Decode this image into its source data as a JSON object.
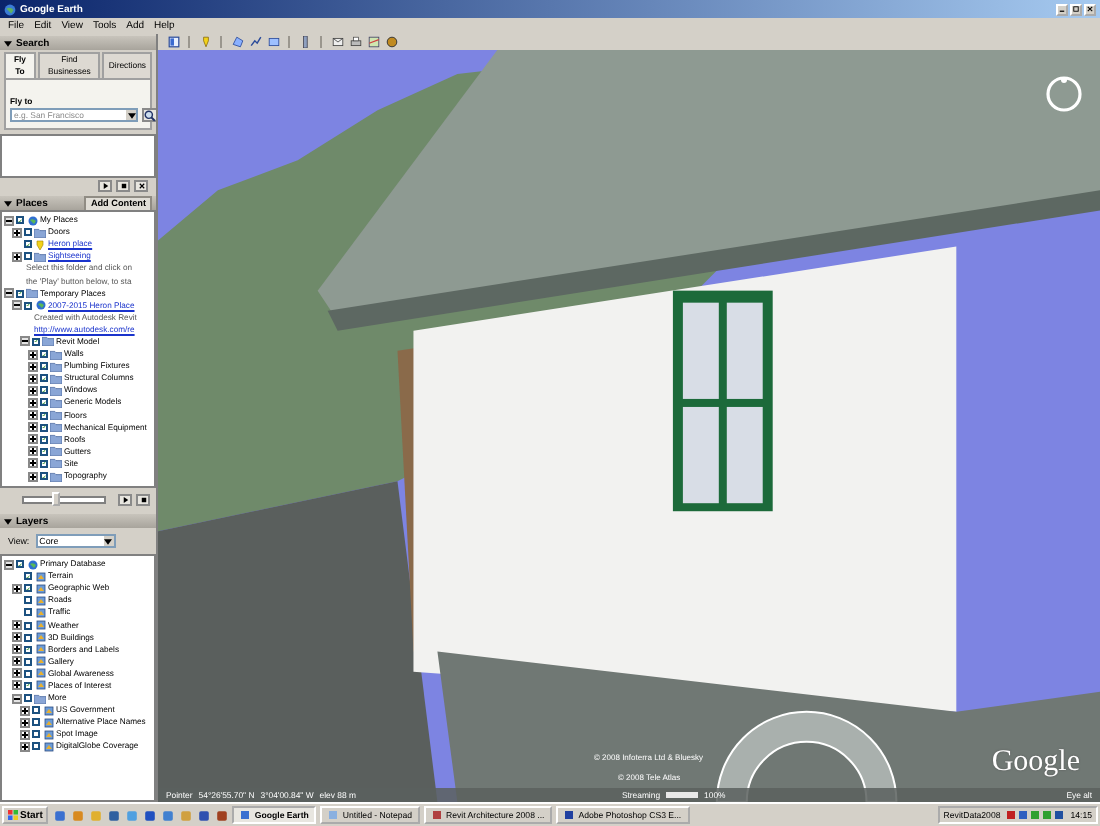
{
  "window": {
    "title": "Google Earth"
  },
  "menu": [
    "File",
    "Edit",
    "View",
    "Tools",
    "Add",
    "Help"
  ],
  "search": {
    "title": "Search",
    "tabs": [
      {
        "label": "Fly To",
        "selected": true
      },
      {
        "label": "Find Businesses",
        "selected": false
      },
      {
        "label": "Directions",
        "selected": false
      }
    ],
    "label": "Fly to",
    "placeholder": "e.g. San Francisco"
  },
  "places": {
    "title": "Places",
    "add_button": "Add Content",
    "items": [
      {
        "kind": "globe",
        "label": "My Places",
        "checked": true,
        "expanded": true,
        "children": [
          {
            "kind": "folder",
            "label": "Doors",
            "checked": false,
            "expanded": false
          },
          {
            "kind": "pin",
            "label": "Heron place",
            "checked": true,
            "link": true
          },
          {
            "kind": "folder",
            "label": "Sightseeing",
            "checked": false,
            "expanded": false,
            "link": true
          },
          {
            "kind": "note",
            "label": "Select this folder and click on"
          },
          {
            "kind": "note",
            "label": "the 'Play' button below, to sta"
          }
        ]
      },
      {
        "kind": "folder",
        "label": "Temporary Places",
        "checked": true,
        "expanded": true,
        "children": [
          {
            "kind": "globe",
            "label": "2007-2015 Heron Place",
            "checked": true,
            "expanded": true,
            "link": true,
            "children": [
              {
                "kind": "note",
                "label": "Created with Autodesk Revit"
              },
              {
                "kind": "note",
                "label": "http://www.autodesk.com/re",
                "link": true
              },
              {
                "kind": "folder",
                "label": "Revit Model",
                "checked": true,
                "expanded": true,
                "children": [
                  {
                    "kind": "folder",
                    "label": "Walls",
                    "checked": true,
                    "expanded": false
                  },
                  {
                    "kind": "folder",
                    "label": "Plumbing Fixtures",
                    "checked": true,
                    "expanded": false
                  },
                  {
                    "kind": "folder",
                    "label": "Structural Columns",
                    "checked": true,
                    "expanded": false
                  },
                  {
                    "kind": "folder",
                    "label": "Windows",
                    "checked": true,
                    "expanded": false
                  },
                  {
                    "kind": "folder",
                    "label": "Generic Models",
                    "checked": true,
                    "expanded": false
                  },
                  {
                    "kind": "folder",
                    "label": "Floors",
                    "checked": true,
                    "expanded": false
                  },
                  {
                    "kind": "folder",
                    "label": "Mechanical Equipment",
                    "checked": true,
                    "expanded": false
                  },
                  {
                    "kind": "folder",
                    "label": "Roofs",
                    "checked": true,
                    "expanded": false
                  },
                  {
                    "kind": "folder",
                    "label": "Gutters",
                    "checked": true,
                    "expanded": false
                  },
                  {
                    "kind": "folder",
                    "label": "Site",
                    "checked": true,
                    "expanded": false
                  },
                  {
                    "kind": "folder",
                    "label": "Topography",
                    "checked": true,
                    "expanded": false
                  }
                ]
              }
            ]
          }
        ]
      }
    ],
    "tour": {
      "level": 0.4
    }
  },
  "layers": {
    "title": "Layers",
    "view_label": "View:",
    "view_value": "Core",
    "items": [
      {
        "kind": "globe",
        "label": "Primary Database",
        "checked": true,
        "expanded": true,
        "children": [
          {
            "kind": "layer",
            "label": "Terrain",
            "checked": true
          },
          {
            "kind": "layer",
            "label": "Geographic Web",
            "checked": true,
            "expanded": false
          },
          {
            "kind": "layer",
            "label": "Roads",
            "checked": false
          },
          {
            "kind": "layer",
            "label": "Traffic",
            "checked": false
          },
          {
            "kind": "layer",
            "label": "Weather",
            "checked": false,
            "expanded": false
          },
          {
            "kind": "layer",
            "label": "3D Buildings",
            "checked": false,
            "expanded": false
          },
          {
            "kind": "layer",
            "label": "Borders and Labels",
            "checked": true,
            "expanded": false
          },
          {
            "kind": "layer",
            "label": "Gallery",
            "checked": false,
            "expanded": false
          },
          {
            "kind": "layer",
            "label": "Global Awareness",
            "checked": false,
            "expanded": false
          },
          {
            "kind": "layer",
            "label": "Places of Interest",
            "checked": true,
            "expanded": false
          },
          {
            "kind": "folder",
            "label": "More",
            "checked": false,
            "expanded": true,
            "children": [
              {
                "kind": "layer",
                "label": "US Government",
                "checked": false,
                "expanded": false
              },
              {
                "kind": "layer",
                "label": "Alternative Place Names",
                "checked": false,
                "expanded": false
              },
              {
                "kind": "layer",
                "label": "Spot Image",
                "checked": false,
                "expanded": false
              },
              {
                "kind": "layer",
                "label": "DigitalGlobe Coverage",
                "checked": false,
                "expanded": false
              }
            ]
          }
        ]
      }
    ]
  },
  "view": {
    "copyrights": [
      "© 2008 Infoterra Ltd & Bluesky",
      "© 2008 Tele Atlas"
    ],
    "logo": "Google",
    "status": {
      "pointer_label": "Pointer",
      "latitude": "54°26'55.70\" N",
      "longitude": "3°04'00.84\" W",
      "elevation": "elev  88 m",
      "streaming_label": "Streaming",
      "streaming": {
        "level": 1
      },
      "streaming_reading": "100%",
      "eye_alt": "Eye alt"
    }
  },
  "taskbar": {
    "start": "Start",
    "tasks": [
      {
        "label": "Google Earth",
        "selected": true
      },
      {
        "label": "Untitled - Notepad",
        "selected": false
      },
      {
        "label": "Revit Architecture 2008 ...",
        "selected": false
      },
      {
        "label": "Adobe Photoshop CS3 E...",
        "selected": false
      }
    ],
    "tray_label": "RevitData2008",
    "clock": "14:15"
  }
}
